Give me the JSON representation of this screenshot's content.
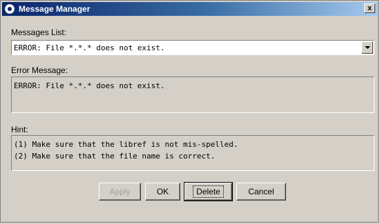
{
  "window": {
    "title": "Message Manager",
    "close_label": "x"
  },
  "messages_list": {
    "label": "Messages List:",
    "selected": "ERROR: File *.*.* does not exist."
  },
  "error_message": {
    "label": "Error Message:",
    "text": "ERROR: File *.*.* does not exist."
  },
  "hint": {
    "label": "Hint:",
    "lines": [
      "(1) Make sure that the libref is not mis-spelled.",
      "(2) Make sure that the file name is correct."
    ]
  },
  "buttons": {
    "apply": "Apply",
    "ok": "OK",
    "delete": "Delete",
    "cancel": "Cancel"
  },
  "colors": {
    "title_bar": "#0a246a",
    "dialog_bg": "#d4d0c8",
    "disabled_text": "#a0a0a0"
  }
}
